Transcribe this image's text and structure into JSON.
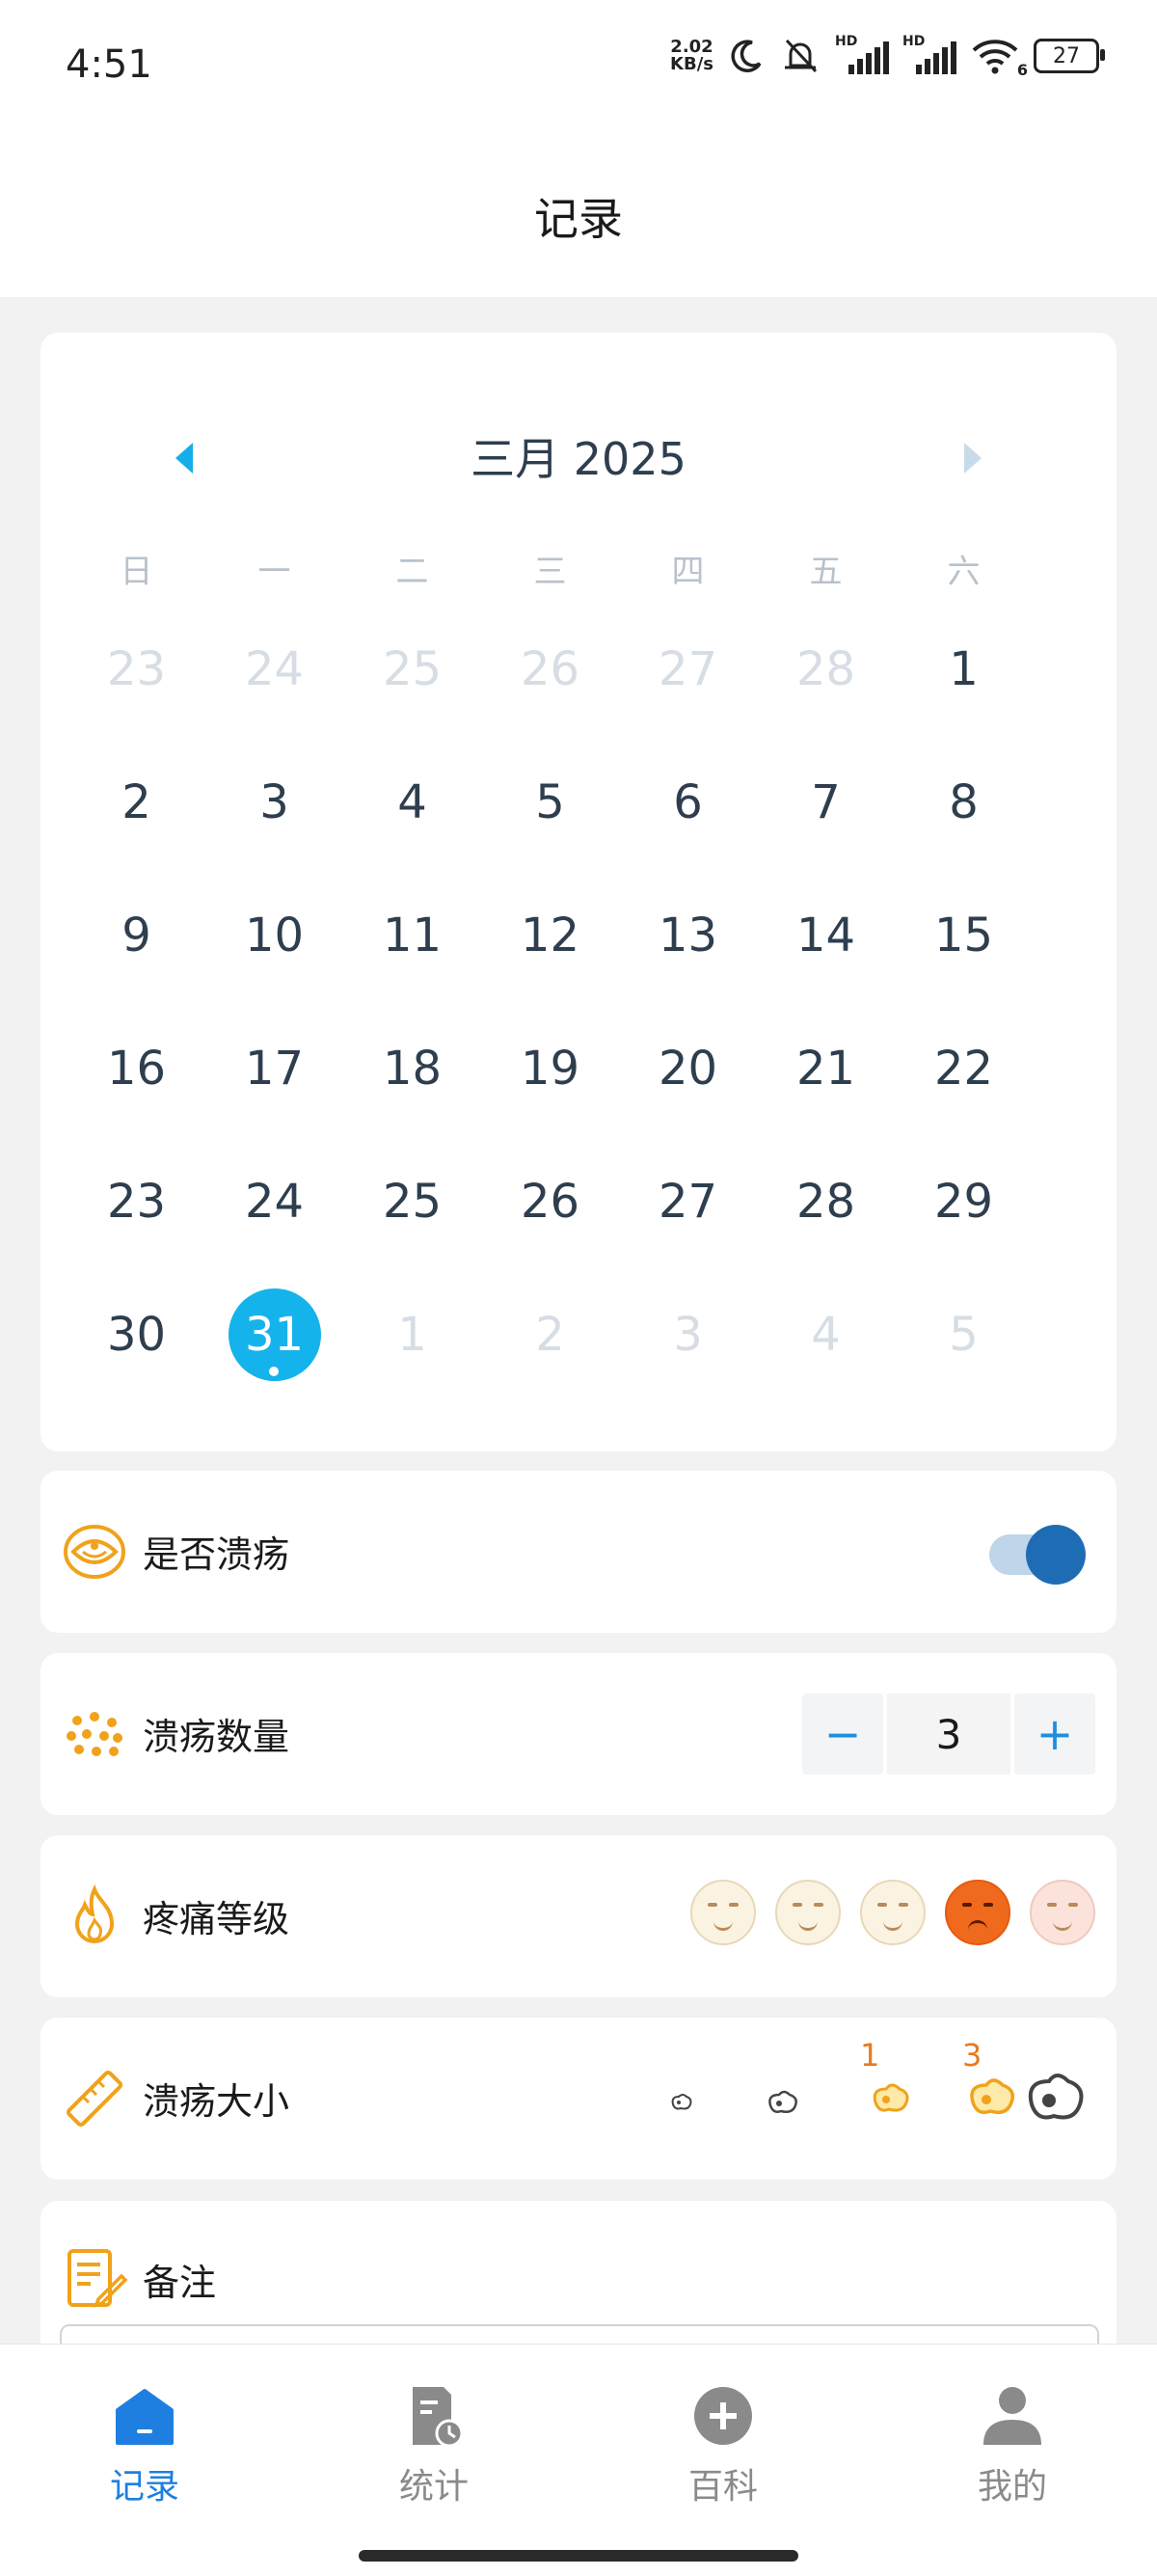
{
  "status_bar": {
    "time": "4:51",
    "net_speed_value": "2.02",
    "net_speed_unit": "KB/s",
    "signal_1_label": "HD",
    "signal_2_label": "HD",
    "wifi_label": "6",
    "battery": "27"
  },
  "header": {
    "title": "记录"
  },
  "calendar": {
    "month_title": "三月 2025",
    "weekdays": [
      "日",
      "一",
      "二",
      "三",
      "四",
      "五",
      "六"
    ],
    "weeks": [
      [
        [
          "23",
          1
        ],
        [
          "24",
          1
        ],
        [
          "25",
          1
        ],
        [
          "26",
          1
        ],
        [
          "27",
          1
        ],
        [
          "28",
          1
        ],
        [
          "1",
          0
        ]
      ],
      [
        [
          "2",
          0
        ],
        [
          "3",
          0
        ],
        [
          "4",
          0
        ],
        [
          "5",
          0
        ],
        [
          "6",
          0
        ],
        [
          "7",
          0
        ],
        [
          "8",
          0
        ]
      ],
      [
        [
          "9",
          0
        ],
        [
          "10",
          0
        ],
        [
          "11",
          0
        ],
        [
          "12",
          0
        ],
        [
          "13",
          0
        ],
        [
          "14",
          0
        ],
        [
          "15",
          0
        ]
      ],
      [
        [
          "16",
          0
        ],
        [
          "17",
          0
        ],
        [
          "18",
          0
        ],
        [
          "19",
          0
        ],
        [
          "20",
          0
        ],
        [
          "21",
          0
        ],
        [
          "22",
          0
        ]
      ],
      [
        [
          "23",
          0
        ],
        [
          "24",
          0
        ],
        [
          "25",
          0
        ],
        [
          "26",
          0
        ],
        [
          "27",
          0
        ],
        [
          "28",
          0
        ],
        [
          "29",
          0
        ]
      ],
      [
        [
          "30",
          0
        ],
        [
          "31",
          2
        ],
        [
          "1",
          1
        ],
        [
          "2",
          1
        ],
        [
          "3",
          1
        ],
        [
          "4",
          1
        ],
        [
          "5",
          1
        ]
      ]
    ],
    "accent": "#15b3ec"
  },
  "ulcer_toggle": {
    "label": "是否溃疡",
    "on": true
  },
  "ulcer_count": {
    "label": "溃疡数量",
    "minus": "−",
    "value": "3",
    "plus": "+"
  },
  "pain_level": {
    "label": "疼痛等级",
    "selected_index": 3,
    "levels": 5
  },
  "ulcer_size": {
    "label": "溃疡大小",
    "counts": [
      {
        "index": 2,
        "count": "1"
      },
      {
        "index": 3,
        "count": "3"
      }
    ]
  },
  "notes": {
    "label": "备注"
  },
  "tabbar": {
    "tabs": [
      {
        "label": "记录",
        "icon": "home-icon",
        "active": true
      },
      {
        "label": "统计",
        "icon": "stats-icon",
        "active": false
      },
      {
        "label": "百科",
        "icon": "plus-circle-icon",
        "active": false
      },
      {
        "label": "我的",
        "icon": "user-icon",
        "active": false
      }
    ],
    "active_color": "#1e7fe0"
  }
}
